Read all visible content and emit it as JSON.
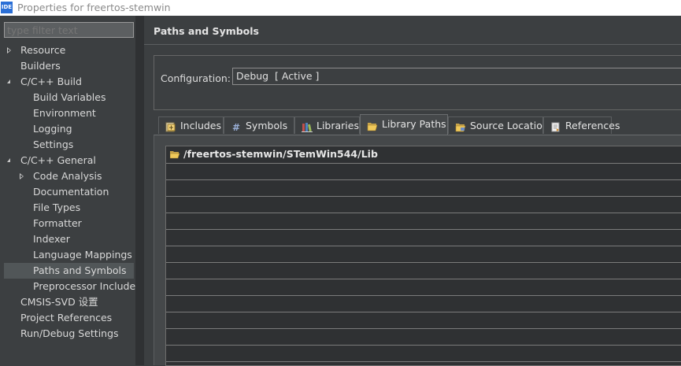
{
  "window": {
    "title": "Properties for freertos-stemwin",
    "icon_text": "IDE"
  },
  "nav": {
    "filter_placeholder": "type filter text",
    "items": [
      {
        "label": "Resource",
        "level": 0,
        "twisty": "closed"
      },
      {
        "label": "Builders",
        "level": 0,
        "twisty": "none"
      },
      {
        "label": "C/C++ Build",
        "level": 0,
        "twisty": "open"
      },
      {
        "label": "Build Variables",
        "level": 1,
        "twisty": "none"
      },
      {
        "label": "Environment",
        "level": 1,
        "twisty": "none"
      },
      {
        "label": "Logging",
        "level": 1,
        "twisty": "none"
      },
      {
        "label": "Settings",
        "level": 1,
        "twisty": "none"
      },
      {
        "label": "C/C++ General",
        "level": 0,
        "twisty": "open"
      },
      {
        "label": "Code Analysis",
        "level": 1,
        "twisty": "closed"
      },
      {
        "label": "Documentation",
        "level": 1,
        "twisty": "none"
      },
      {
        "label": "File Types",
        "level": 1,
        "twisty": "none"
      },
      {
        "label": "Formatter",
        "level": 1,
        "twisty": "none"
      },
      {
        "label": "Indexer",
        "level": 1,
        "twisty": "none"
      },
      {
        "label": "Language Mappings",
        "level": 1,
        "twisty": "none"
      },
      {
        "label": "Paths and Symbols",
        "level": 1,
        "twisty": "none",
        "selected": true
      },
      {
        "label": "Preprocessor Include",
        "level": 1,
        "twisty": "none"
      },
      {
        "label": "CMSIS-SVD 设置",
        "level": 0,
        "twisty": "none"
      },
      {
        "label": "Project References",
        "level": 0,
        "twisty": "none"
      },
      {
        "label": "Run/Debug Settings",
        "level": 0,
        "twisty": "none"
      }
    ]
  },
  "page": {
    "title": "Paths and Symbols",
    "config_label": "Configuration:",
    "config_value": "Debug  [ Active ]"
  },
  "tabs": [
    {
      "label": "Includes",
      "icon": "includes-icon"
    },
    {
      "label": "Symbols",
      "icon": "hash-icon"
    },
    {
      "label": "Libraries",
      "icon": "libraries-icon"
    },
    {
      "label": "Library Paths",
      "icon": "folder-open-icon",
      "active": true
    },
    {
      "label": "Source Location",
      "icon": "source-folder-icon"
    },
    {
      "label": "References",
      "icon": "references-icon"
    }
  ],
  "library_paths": [
    "/freertos-stemwin/STemWin544/Lib"
  ],
  "colors": {
    "background": "#3c3f41",
    "list_background": "#2f3133",
    "selected_nav": "#515658"
  }
}
